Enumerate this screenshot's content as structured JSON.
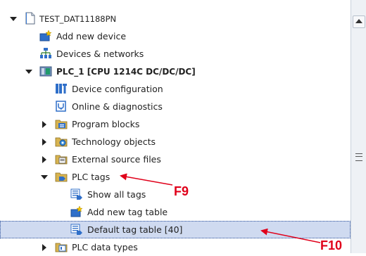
{
  "tree": {
    "items": [
      {
        "label": "TEST_DAT11188PN",
        "expander": "expanded",
        "icon": "project-file-icon"
      },
      {
        "label": "Add new device",
        "expander": "none",
        "icon": "add-device-icon"
      },
      {
        "label": "Devices & networks",
        "expander": "none",
        "icon": "devices-networks-icon"
      },
      {
        "label": "PLC_1 [CPU 1214C DC/DC/DC]",
        "expander": "expanded",
        "icon": "plc-cpu-icon"
      },
      {
        "label": "Device configuration",
        "expander": "none",
        "icon": "device-configuration-icon"
      },
      {
        "label": "Online & diagnostics",
        "expander": "none",
        "icon": "online-diagnostics-icon"
      },
      {
        "label": "Program blocks",
        "expander": "collapsed",
        "icon": "program-blocks-folder-icon"
      },
      {
        "label": "Technology objects",
        "expander": "collapsed",
        "icon": "technology-objects-folder-icon"
      },
      {
        "label": "External source files",
        "expander": "collapsed",
        "icon": "external-source-files-folder-icon"
      },
      {
        "label": "PLC tags",
        "expander": "expanded",
        "icon": "plc-tags-folder-icon"
      },
      {
        "label": "Show all tags",
        "expander": "none",
        "icon": "show-all-tags-icon"
      },
      {
        "label": "Add new tag table",
        "expander": "none",
        "icon": "add-tag-table-icon"
      },
      {
        "label": "Default tag table [40]",
        "expander": "none",
        "icon": "tag-table-icon",
        "selected": true
      },
      {
        "label": "PLC data types",
        "expander": "collapsed",
        "icon": "plc-data-types-folder-icon"
      }
    ]
  },
  "annotations": [
    {
      "label": "F9",
      "color": "#e0001a"
    },
    {
      "label": "F10",
      "color": "#e0001a"
    }
  ],
  "colors": {
    "selection": "#cfdaf0",
    "annotation": "#e0001a"
  }
}
